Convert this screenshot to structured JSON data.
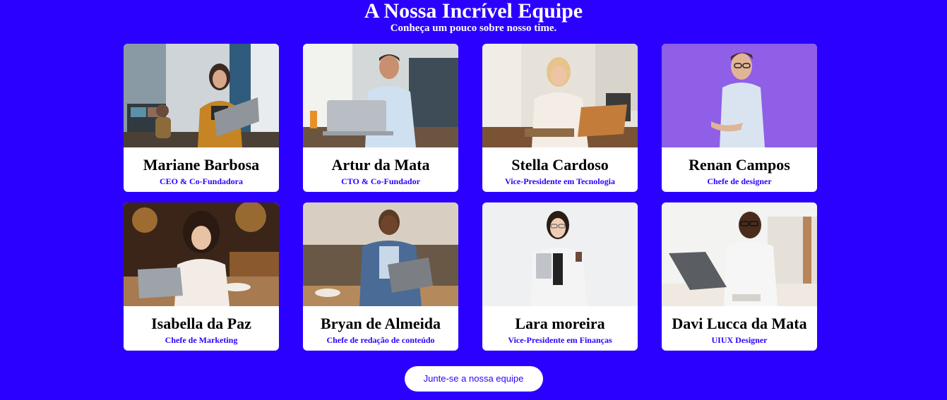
{
  "header": {
    "title": "A Nossa Incrível Equipe",
    "subtitle": "Conheça um pouco sobre nosso time."
  },
  "team": [
    {
      "name": "Mariane Barbosa",
      "role": "CEO & Co-Fundadora",
      "photo": "woman-with-laptop-office"
    },
    {
      "name": "Artur da Mata",
      "role": "CTO & Co-Fundador",
      "photo": "man-at-laptop-desk"
    },
    {
      "name": "Stella Cardoso",
      "role": "Vice-Presidente em Tecnologia",
      "photo": "woman-writing-notebook"
    },
    {
      "name": "Renan Campos",
      "role": "Chefe de designer",
      "photo": "man-glasses-purple-bg"
    },
    {
      "name": "Isabella da Paz",
      "role": "Chefe de Marketing",
      "photo": "woman-laptop-cafe"
    },
    {
      "name": "Bryan de Almeida",
      "role": "Chefe de redação de conteúdo",
      "photo": "man-with-tablet-cafe"
    },
    {
      "name": "Lara moreira",
      "role": "Vice-Presidente em Finanças",
      "photo": "woman-with-coffee-white-bg"
    },
    {
      "name": "Davi Lucca da Mata",
      "role": "UIUX Designer",
      "photo": "man-laptop-bright-office"
    }
  ],
  "cta": {
    "label": "Junte-se a nossa equipe"
  },
  "colors": {
    "background": "#2b00ff",
    "card": "#ffffff",
    "accent": "#2b00ff"
  }
}
